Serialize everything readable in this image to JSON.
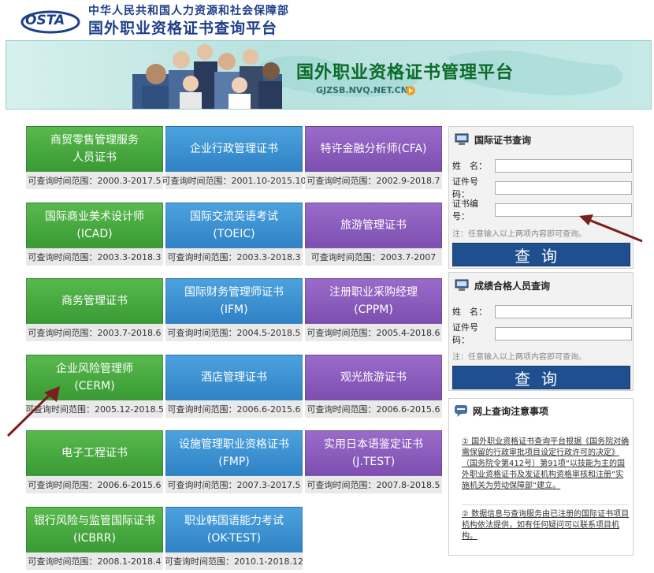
{
  "header": {
    "ministry": "中华人民共和国人力资源和社会保障部",
    "title": "国外职业资格证书查询平台",
    "logo_text": "OSTA"
  },
  "banner": {
    "title": "国外职业资格证书管理平台",
    "url": "GJZSB.NVQ.NET.CN"
  },
  "certs": [
    {
      "label": "商贸零售管理服务\n人员证书",
      "range": "可查询时间范围：2000.3-2017.5"
    },
    {
      "label": "企业行政管理证书",
      "range": "可查询时间范围：2001.10-2015.10"
    },
    {
      "label": "特许金融分析师(CFA)",
      "range": "可查询时间范围：2002.9-2018.7"
    },
    {
      "label": "国际商业美术设计师\n(ICAD)",
      "range": "可查询时间范围：2003.3-2018.3"
    },
    {
      "label": "国际交流英语考试\n(TOEIC)",
      "range": "可查询时间范围：2003.3-2018.3"
    },
    {
      "label": "旅游管理证书",
      "range": "可查询时间范围：2003.7-2007"
    },
    {
      "label": "商务管理证书",
      "range": "可查询时间范围：2003.7-2018.6"
    },
    {
      "label": "国际财务管理师证书\n(IFM)",
      "range": "可查询时间范围：2004.5-2018.5"
    },
    {
      "label": "注册职业采购经理\n(CPPM)",
      "range": "可查询时间范围：2005.4-2018.6"
    },
    {
      "label": "企业风险管理师\n(CERM)",
      "range": "可查询时间范围：2005.12-2018.5"
    },
    {
      "label": "酒店管理证书",
      "range": "可查询时间范围：2006.6-2015.6"
    },
    {
      "label": "观光旅游证书",
      "range": "可查询时间范围：2006.6-2015.6"
    },
    {
      "label": "电子工程证书",
      "range": "可查询时间范围：2006.6-2015.6"
    },
    {
      "label": "设施管理职业资格证书\n(FMP)",
      "range": "可查询时间范围：2007.3-2017.5"
    },
    {
      "label": "实用日本语鉴定证书\n(J.TEST)",
      "range": "可查询时间范围：2007.8-2018.5"
    },
    {
      "label": "银行风险与监管国际证书\n(ICBRR)",
      "range": "可查询时间范围：2008.1-2018.4"
    },
    {
      "label": "职业韩国语能力考试\n(OK-TEST)",
      "range": "可查询时间范围：2010.1-2018.12"
    }
  ],
  "intl_query": {
    "title": "国际证书查询",
    "name_label": "姓　名：",
    "idno_label": "证件号码：",
    "certno_label": "证书编号：",
    "name_value": "",
    "idno_value": "",
    "certno_value": "",
    "note": "注：任意输入以上两项内容即可查询。",
    "button": "查询"
  },
  "score_query": {
    "title": "成绩合格人员查询",
    "name_label": "姓　名：",
    "idno_label": "证件号码：",
    "name_value": "",
    "idno_value": "",
    "note": "注：任意输入以上两项内容即可查询。",
    "button": "查询"
  },
  "notice": {
    "title": "网上查询注意事项",
    "item1": "① 国外职业资格证书查询平台根据《国务院对确需保留的行政审批项目设定行政许可的决定》（国务院令第412号）第91项“以技能为主的国外职业资格证书及发证机构资格审核和注册”实施机关为劳动保障部”建立。",
    "item2": "② 数据信息与查询服务由已注册的国际证书项目机构依法提供，如有任何疑问可以联系项目机构。"
  },
  "colors": {
    "green": "#3a9a34",
    "blue": "#2f82c5",
    "purple": "#7c4fb0",
    "query_button": "#1f4f8e"
  }
}
